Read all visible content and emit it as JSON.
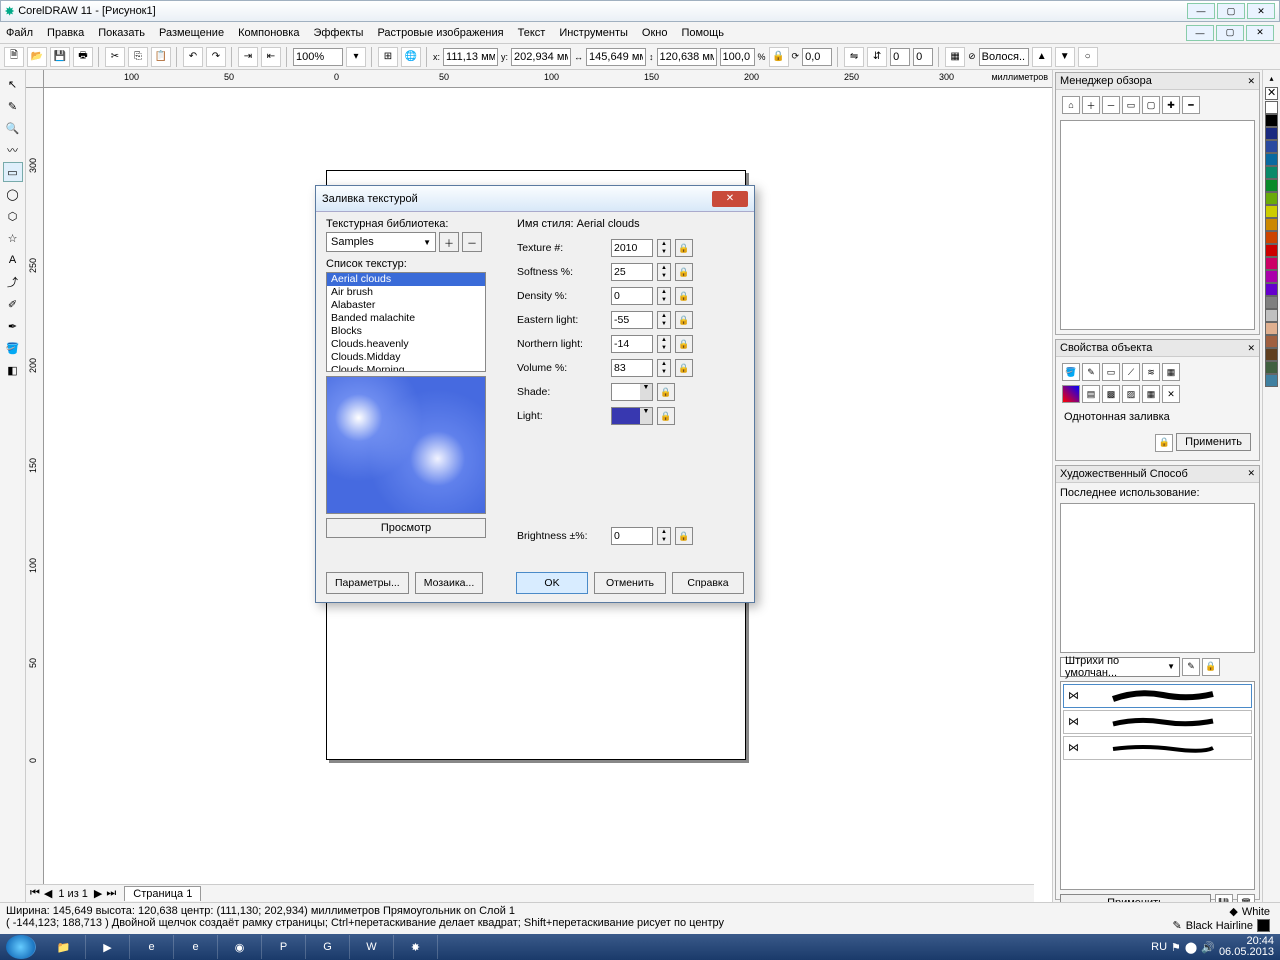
{
  "title": "CorelDRAW 11 - [Рисунок1]",
  "menu": [
    "Файл",
    "Правка",
    "Показать",
    "Размещение",
    "Компоновка",
    "Эффекты",
    "Растровые изображения",
    "Текст",
    "Инструменты",
    "Окно",
    "Помощь"
  ],
  "toolbar": {
    "zoom": "100%",
    "x": "111,13 мм",
    "y": "202,934 мм",
    "w": "145,649 мм",
    "h": "120,638 мм",
    "sx": "100,0",
    "sy": "100,0",
    "rot": "0,0",
    "ox": "0",
    "oy": "0",
    "hair": "Волося..."
  },
  "ruler_units": "миллиметров",
  "ruler_h": [
    "",
    "100",
    "50",
    "0",
    "50",
    "100",
    "150",
    "200",
    "250",
    "300"
  ],
  "ruler_v": [
    "300",
    "250",
    "200",
    "150",
    "100",
    "50",
    "0"
  ],
  "pagebar": {
    "counter": "1 из 1",
    "tab": "Страница 1"
  },
  "status1": "Ширина: 145,649  высота: 120,638  центр: (111,130; 202,934)  миллиметров       Прямоугольник on Слой 1",
  "status2": "( -144,123; 188,713 )      Двойной щелчок создаёт рамку страницы; Ctrl+перетаскивание делает квадрат; Shift+перетаскивание рисует по центру",
  "status_fill_none": "White",
  "status_outline": "Black  Hairline",
  "dockers": {
    "overview": "Менеджер обзора",
    "props": "Свойства объекта",
    "props_label": "Однотонная заливка",
    "props_apply": "Применить",
    "art": "Художественный Способ",
    "art_last": "Последнее использование:",
    "art_stroke_combo": "Штрихи по умолчан...",
    "art_apply": "Применить"
  },
  "dialog": {
    "title": "Заливка текстурой",
    "lib_label": "Текстурная библиотека:",
    "lib_value": "Samples",
    "list_label": "Список текстур:",
    "textures": [
      "Aerial clouds",
      "Air brush",
      "Alabaster",
      "Banded malachite",
      "Blocks",
      "Clouds.heavenly",
      "Clouds.Midday",
      "Clouds.Morning"
    ],
    "selected_texture_index": 0,
    "preview_btn": "Просмотр",
    "style_label": "Имя стиля: Aerial clouds",
    "params": {
      "texture_num": {
        "label": "Texture #:",
        "value": "2010"
      },
      "softness": {
        "label": "Softness %:",
        "value": "25"
      },
      "density": {
        "label": "Density %:",
        "value": "0"
      },
      "eastern": {
        "label": "Eastern light:",
        "value": "-55"
      },
      "northern": {
        "label": "Northern light:",
        "value": "-14"
      },
      "volume": {
        "label": "Volume %:",
        "value": "83"
      },
      "shade": {
        "label": "Shade:",
        "color": "#ffffff"
      },
      "light": {
        "label": "Light:",
        "color": "#3838b0"
      },
      "brightness": {
        "label": "Brightness ±%:",
        "value": "0"
      }
    },
    "buttons": {
      "params": "Параметры...",
      "tile": "Мозаика...",
      "ok": "OK",
      "cancel": "Отменить",
      "help": "Справка"
    }
  },
  "taskbar": {
    "lang": "RU",
    "time": "20:44",
    "date": "06.05.2013"
  },
  "palette": [
    "#ffffff",
    "#000000",
    "#1a2a80",
    "#2a4aa0",
    "#0a6aa0",
    "#0a8a6a",
    "#0a8a2a",
    "#6aaa0a",
    "#cccc00",
    "#cc8800",
    "#cc4400",
    "#cc0000",
    "#cc0066",
    "#aa00aa",
    "#6600cc",
    "#808080",
    "#c0c0c0",
    "#e0b090",
    "#a06040",
    "#604020",
    "#406040",
    "#4080a0"
  ]
}
